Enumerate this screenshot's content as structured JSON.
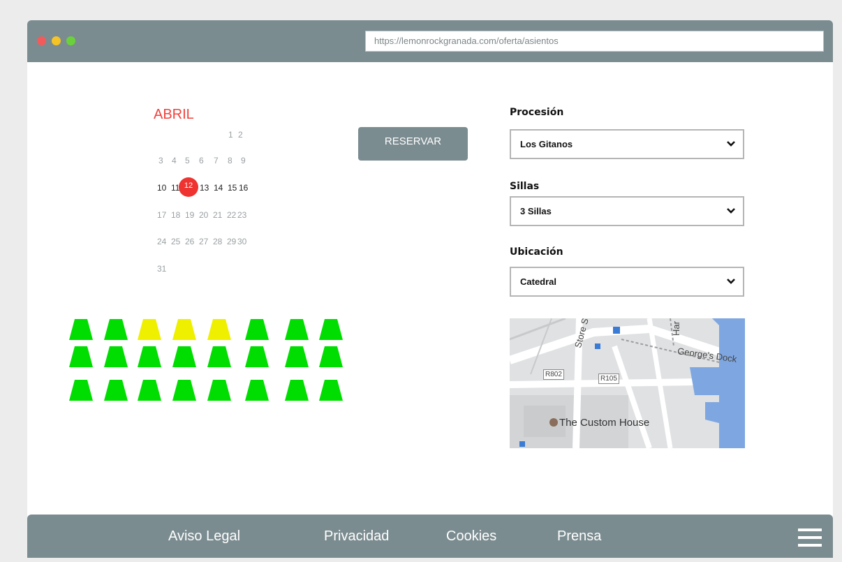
{
  "browser": {
    "url": "https://lemonrockgranada.com/oferta/asientos",
    "dot_colors": [
      "#f15b5b",
      "#f6c425",
      "#6ad13c"
    ]
  },
  "calendar": {
    "month": "ABRIL",
    "selected_day": "12",
    "weeks": [
      [
        "1",
        "2"
      ],
      [
        "3",
        "4",
        "5",
        "6",
        "7",
        "8",
        "9"
      ],
      [
        "10",
        "11",
        "12",
        "13",
        "14",
        "15",
        "16"
      ],
      [
        "17",
        "18",
        "19",
        "20",
        "21",
        "22",
        "23"
      ],
      [
        "24",
        "25",
        "26",
        "27",
        "28",
        "29",
        "30"
      ],
      [
        "31"
      ]
    ]
  },
  "reserve_button": {
    "label": "RESERVAR"
  },
  "form": {
    "procesion": {
      "label": "Procesión",
      "value": "Los Gitanos"
    },
    "sillas": {
      "label": "Sillas",
      "value": "3 Sillas"
    },
    "ubicacion": {
      "label": "Ubicación",
      "value": "Catedral"
    }
  },
  "seats": {
    "colors": {
      "available": "#00dd00",
      "selected": "#eef000"
    },
    "rows": [
      [
        "available",
        "available",
        "selected",
        "selected",
        "selected",
        "available",
        "available",
        "available"
      ],
      [
        "available",
        "available",
        "available",
        "available",
        "available",
        "available",
        "available",
        "available"
      ],
      [
        "available",
        "available",
        "available",
        "available",
        "available",
        "available",
        "available",
        "available"
      ]
    ]
  },
  "map": {
    "labels": {
      "store_st": "Store St",
      "georges_dock": "George's Dock",
      "r802": "R802",
      "r105": "R105",
      "custom_house": "The Custom House",
      "har": "Har"
    }
  },
  "footer": {
    "links": [
      "Aviso Legal",
      "Privacidad",
      "Cookies",
      "Prensa"
    ]
  }
}
